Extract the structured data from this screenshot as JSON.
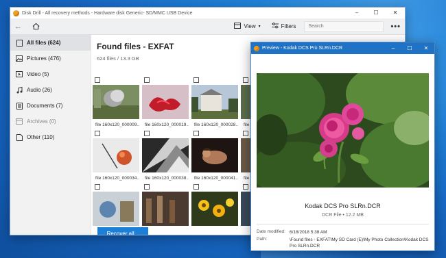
{
  "main_window": {
    "title": "Disk Drill - All recovery methods - Hardware disk Generic- SD/MMC USB Device",
    "controls": [
      "–",
      "☐",
      "✕"
    ],
    "toolbar": {
      "view_label": "View",
      "filters_label": "Filters",
      "search_placeholder": "Search"
    },
    "sidebar": {
      "items": [
        {
          "label": "All files (624)",
          "icon": "all-files-icon"
        },
        {
          "label": "Pictures (476)",
          "icon": "pictures-icon"
        },
        {
          "label": "Video (5)",
          "icon": "video-icon"
        },
        {
          "label": "Audio (26)",
          "icon": "audio-icon"
        },
        {
          "label": "Documents (7)",
          "icon": "documents-icon"
        },
        {
          "label": "Archives (0)",
          "icon": "archives-icon"
        },
        {
          "label": "Other (110)",
          "icon": "other-icon"
        }
      ]
    },
    "content": {
      "title": "Found files - EXFAT",
      "subtitle": "624 files / 13.3 GB",
      "files": [
        {
          "caption": "file 160x120_000009..."
        },
        {
          "caption": "file 160x120_000019..."
        },
        {
          "caption": "file 160x120_000028..."
        },
        {
          "caption": "file 1"
        },
        {
          "caption": "file 160x120_000034..."
        },
        {
          "caption": "file 160x120_000038..."
        },
        {
          "caption": "file 160x120_000041..."
        },
        {
          "caption": "file 1"
        },
        {
          "caption": ""
        },
        {
          "caption": ""
        },
        {
          "caption": ""
        },
        {
          "caption": ""
        }
      ],
      "recover_label": "Recover all..."
    }
  },
  "preview_window": {
    "title": "Preview - Kodak DCS Pro SLRn.DCR",
    "controls": [
      "–",
      "☐",
      "✕"
    ],
    "file_name": "Kodak DCS Pro SLRn.DCR",
    "file_meta": "DCR File • 12.2 MB",
    "date_label": "Date modified:",
    "date_value": "6/18/2018 5:38 AM",
    "path_label": "Path:",
    "path_value": "\\Found files - EXFAT\\My SD Card (E)\\My Photo Collection\\Kodak DCS Pro SLRn.DCR"
  },
  "colors": {
    "accent": "#1c7fd8",
    "preview_titlebar": "#1f72c4",
    "desktop": "#1f7fd6"
  }
}
